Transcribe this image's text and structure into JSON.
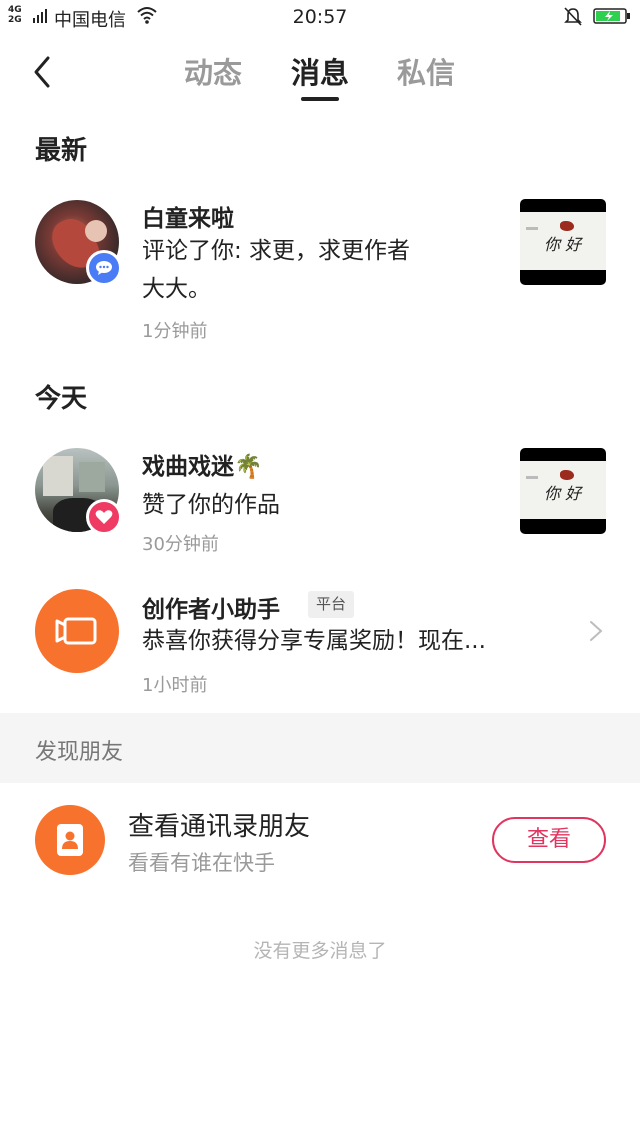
{
  "status_bar": {
    "network": "4G\n2G",
    "carrier": "中国电信",
    "time": "20:57"
  },
  "header": {
    "tabs": [
      {
        "label": "动态",
        "active": false
      },
      {
        "label": "消息",
        "active": true
      },
      {
        "label": "私信",
        "active": false
      }
    ]
  },
  "sections": {
    "latest_title": "最新",
    "today_title": "今天"
  },
  "notifications": [
    {
      "name": "白童来啦",
      "message": "评论了你: 求更，求更作者大大。",
      "message_line1": "评论了你: 求更，求更作者",
      "message_line2": "大大。",
      "time": "1分钟前",
      "badge_icon": "comment-icon",
      "badge_color": "#4a7cf6"
    },
    {
      "name": "戏曲戏迷🌴",
      "message": "赞了你的作品",
      "time": "30分钟前",
      "badge_icon": "heart-icon",
      "badge_color": "#ef3a63"
    },
    {
      "name": "创作者小助手",
      "tag": "平台",
      "message": "恭喜你获得分享专属奖励！现在...",
      "time": "1小时前",
      "icon": "video-camera-icon",
      "icon_color": "#f7722c"
    }
  ],
  "thumbnail_text": "你 好",
  "discover": {
    "title": "发现朋友",
    "contacts_title": "查看通讯录朋友",
    "contacts_subtitle": "看看有谁在快手",
    "view_button": "查看"
  },
  "footer": {
    "no_more": "没有更多消息了"
  },
  "colors": {
    "accent": "#e0355f",
    "orange": "#f7722c"
  }
}
